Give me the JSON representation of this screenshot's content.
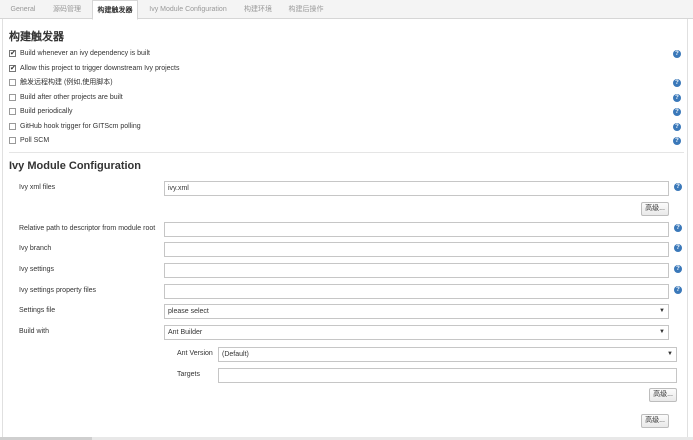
{
  "tabs": [
    {
      "label": "General",
      "active": false
    },
    {
      "label": "源码管理",
      "active": false
    },
    {
      "label": "构建触发器",
      "active": true
    },
    {
      "label": "Ivy Module Configuration",
      "active": false
    },
    {
      "label": "构建环境",
      "active": false
    },
    {
      "label": "构建后操作",
      "active": false
    }
  ],
  "triggers": {
    "title": "构建触发器",
    "items": [
      {
        "label": "Build whenever an ivy dependency is built",
        "checked": true
      },
      {
        "label": "Allow this project to trigger downstream Ivy projects",
        "checked": true
      },
      {
        "label": "触发远程构建 (例如,使用脚本)",
        "checked": false
      },
      {
        "label": "Build after other projects are built",
        "checked": false
      },
      {
        "label": "Build periodically",
        "checked": false
      },
      {
        "label": "GitHub hook trigger for GITScm polling",
        "checked": false
      },
      {
        "label": "Poll SCM",
        "checked": false
      }
    ]
  },
  "ivy": {
    "title": "Ivy Module Configuration",
    "ivy_xml_files": {
      "label": "Ivy xml files",
      "value": "ivy.xml"
    },
    "advanced_label": "高级...",
    "relative_path": {
      "label": "Relative path to descriptor from module root",
      "value": ""
    },
    "ivy_branch": {
      "label": "Ivy branch",
      "value": ""
    },
    "ivy_settings": {
      "label": "Ivy settings",
      "value": ""
    },
    "ivy_settings_property_files": {
      "label": "Ivy settings property files",
      "value": ""
    },
    "settings_file": {
      "label": "Settings file",
      "value": "please select"
    },
    "build_with": {
      "label": "Build with",
      "value": "Ant Builder"
    },
    "ant_version": {
      "label": "Ant Version",
      "value": "(Default)"
    },
    "targets": {
      "label": "Targets",
      "value": ""
    }
  },
  "help_icon_glyph": "?",
  "select_arrow_glyph": "▼",
  "check_glyph": "✔",
  "colors": {
    "help": "#3a78b9",
    "border": "#c6c6c6"
  }
}
